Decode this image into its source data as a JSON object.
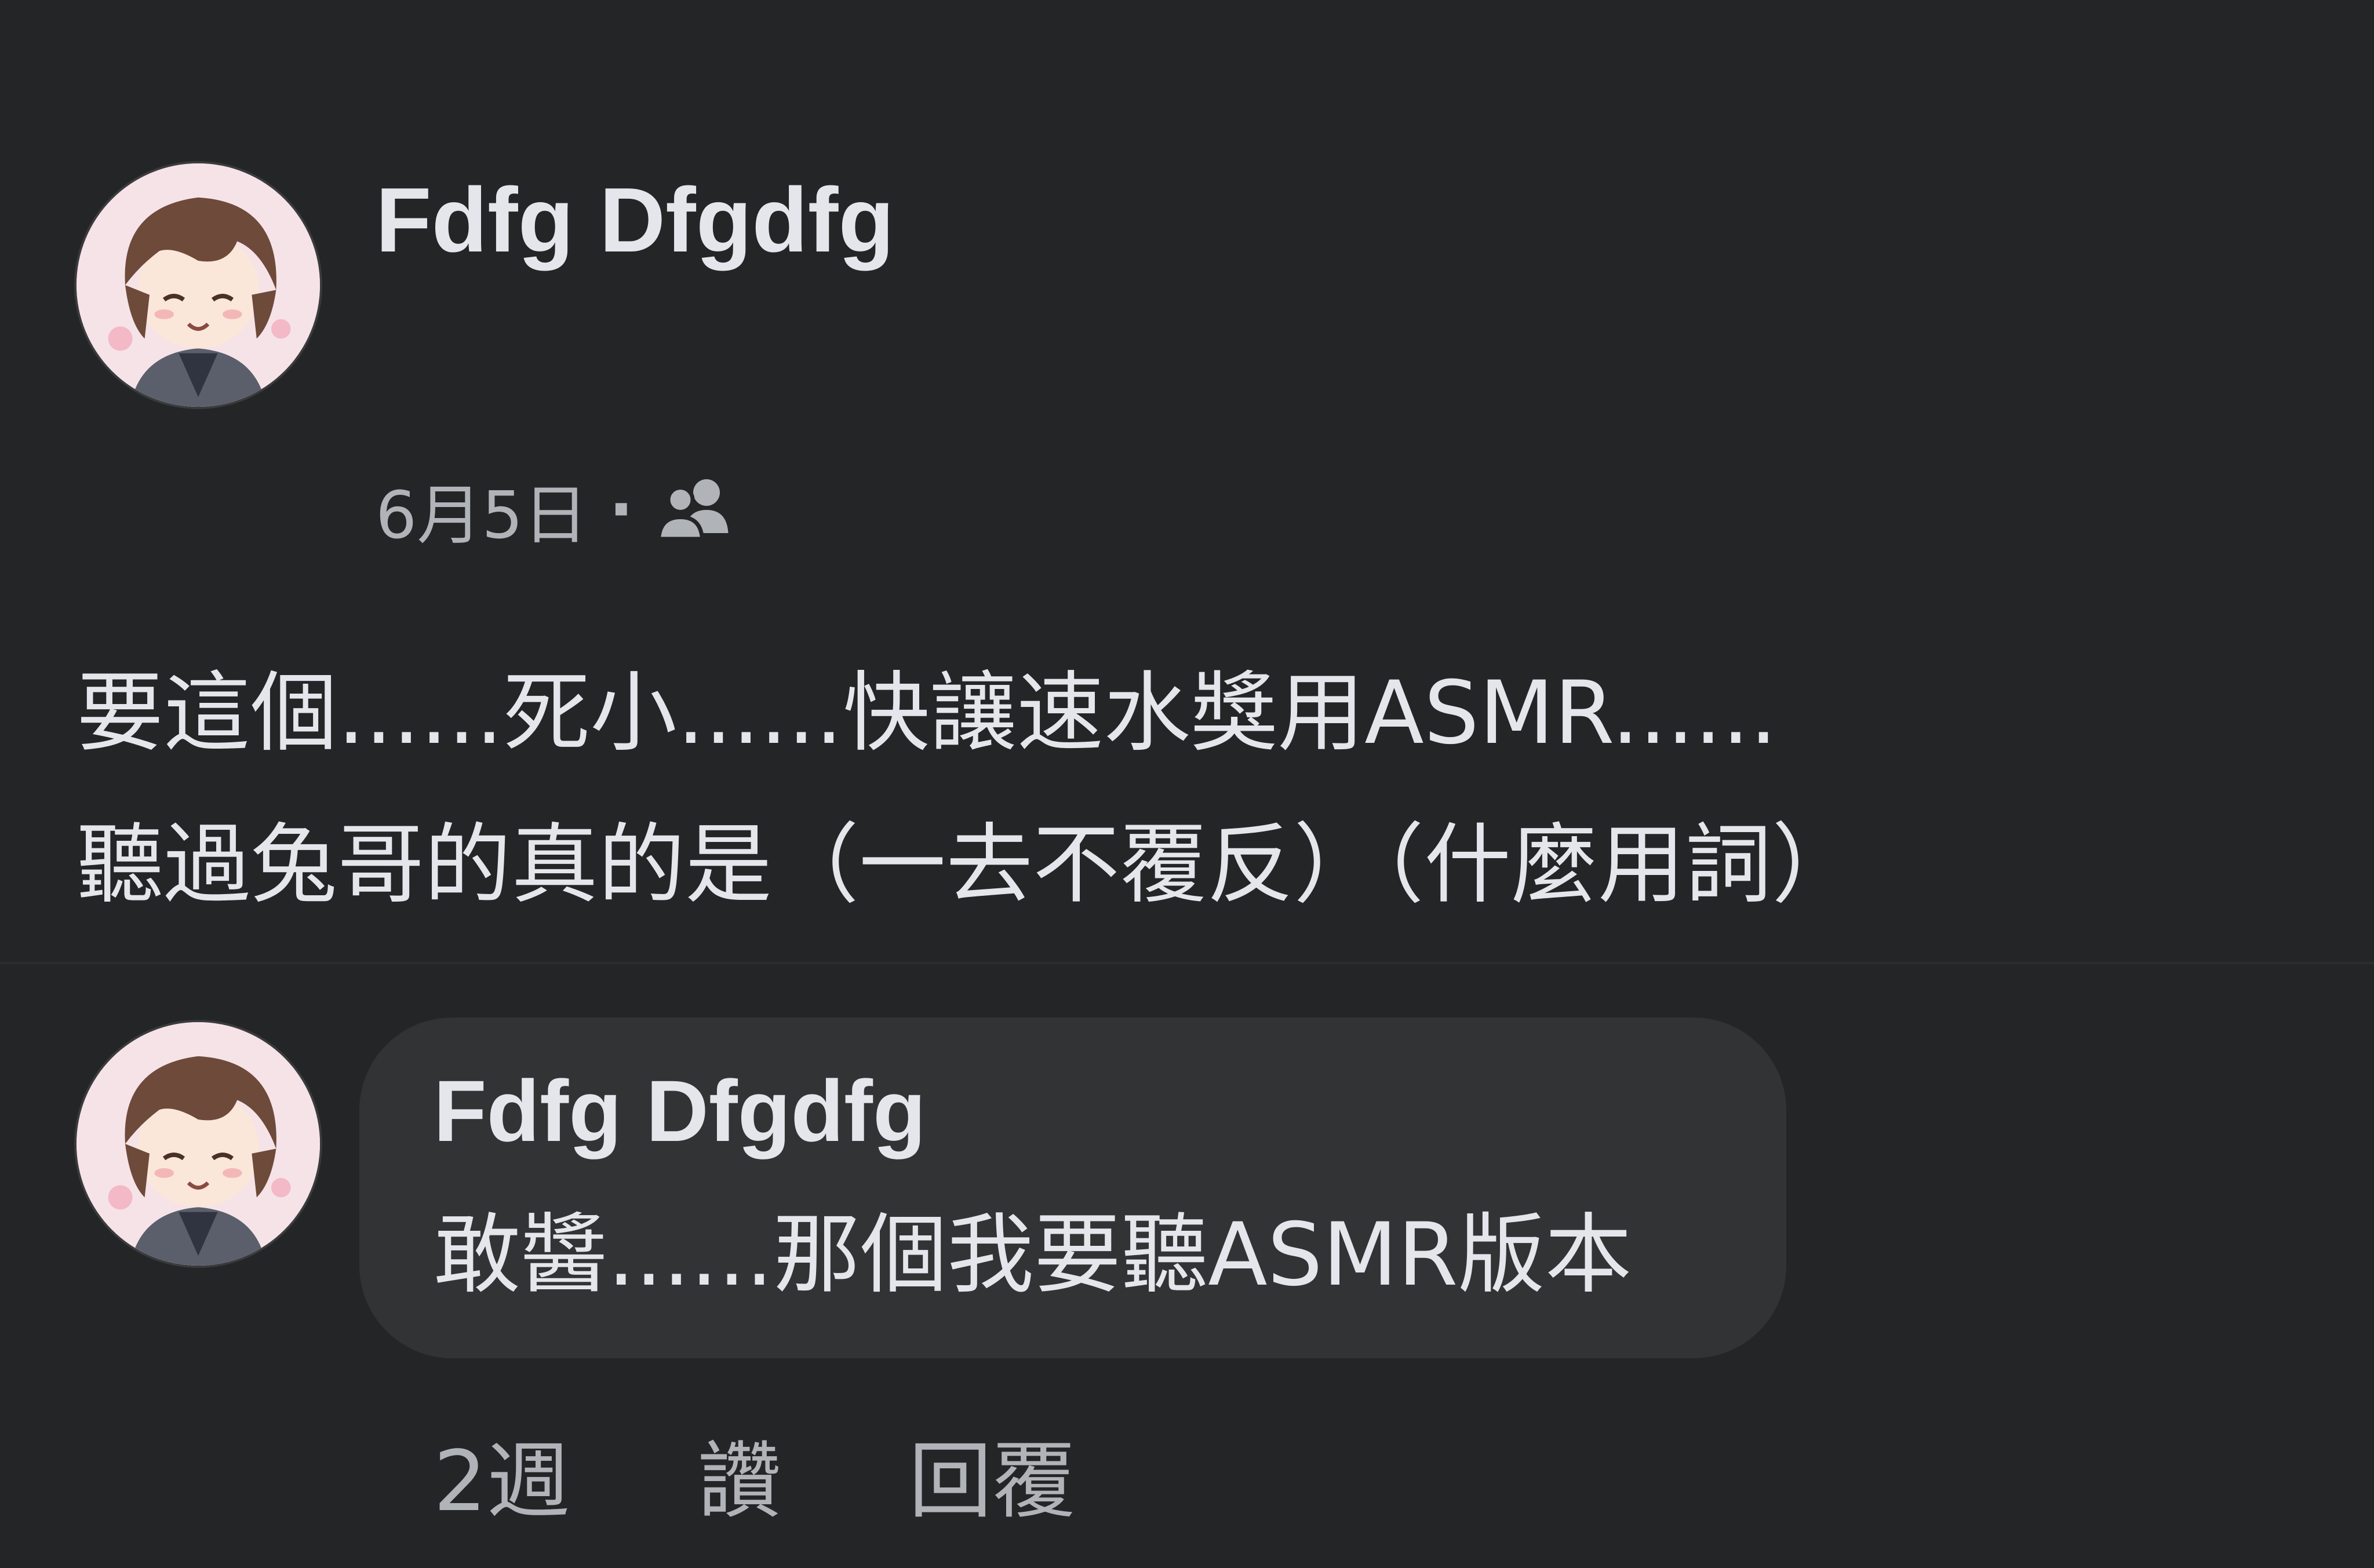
{
  "post": {
    "author": "Fdfg Dfgdfg",
    "date": "6月5日",
    "separator": "·",
    "audience_icon": "friends-icon",
    "body_lines": [
      "要這個......死小......快讓速水獎用ASMR......",
      "聽過兔哥的真的是（一去不覆反）（什麼用詞）"
    ]
  },
  "comment": {
    "author": "Fdfg Dfgdfg",
    "text": "敢醬......那個我要聽ASMR版本",
    "time": "2週",
    "like_label": "讚",
    "reply_label": "回覆"
  },
  "colors": {
    "background": "#242527",
    "bubble": "#323335",
    "primary_text": "#e4e6eb",
    "secondary_text": "#b0b3b8"
  }
}
